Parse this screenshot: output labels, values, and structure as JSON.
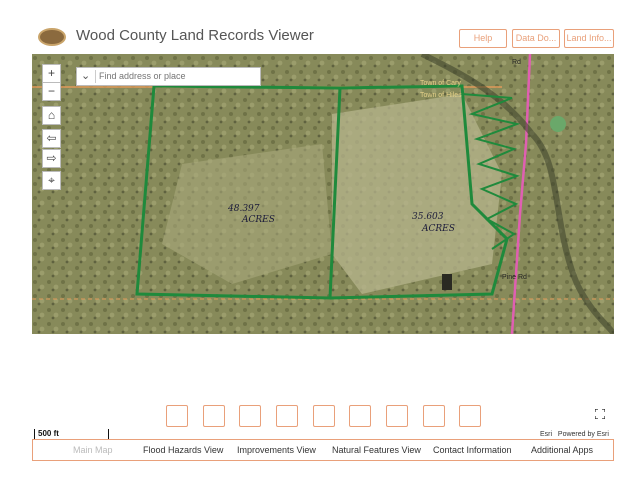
{
  "header": {
    "title": "Wood County Land Records Viewer",
    "buttons": [
      "Help",
      "Data Do...",
      "Land Info..."
    ]
  },
  "search": {
    "placeholder": "Find address or place"
  },
  "map_controls": [
    "+",
    "−",
    "⌂",
    "⇦",
    "⇨",
    "⌖"
  ],
  "map_labels": {
    "town1": "Town of Cary",
    "town2": "Town of Hiles",
    "parcel1": "48.397",
    "parcel1_unit": "ACRES",
    "parcel2": "35.603",
    "parcel2_unit": "ACRES",
    "road1": "Rd",
    "road2": "Pine Rd"
  },
  "scale_bar": "500 ft",
  "attribution": {
    "esri": "Esri",
    "powered": "Powered by Esri"
  },
  "nav": {
    "items": [
      "Main Map",
      "Flood Hazards View",
      "Improvements View",
      "Natural Features View",
      "Contact Information",
      "Additional Apps"
    ]
  },
  "colors": {
    "accent": "#e9a07a",
    "parcel_outline": "#1f8a3c"
  }
}
